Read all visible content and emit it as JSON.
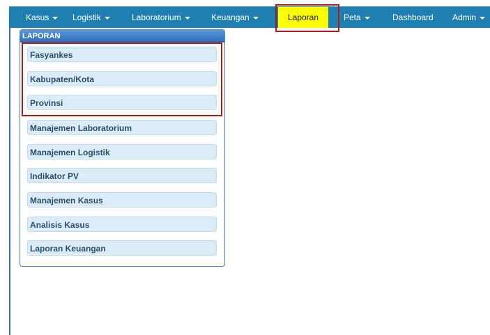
{
  "navbar": {
    "items": [
      {
        "label": "Kasus"
      },
      {
        "label": "Logistik"
      },
      {
        "label": "Laboratorium"
      },
      {
        "label": "Keuangan"
      },
      {
        "label": "Laporan"
      },
      {
        "label": "Peta"
      },
      {
        "label": "Dashboard"
      },
      {
        "label": "Admin"
      }
    ]
  },
  "panel": {
    "title": "LAPORAN",
    "items": [
      {
        "label": "Fasyankes"
      },
      {
        "label": "Kabupaten/Kota"
      },
      {
        "label": "Provinsi"
      },
      {
        "label": "Manajemen Laboratorium"
      },
      {
        "label": "Manajemen Logistik"
      },
      {
        "label": "Indikator PV"
      },
      {
        "label": "Manajemen Kasus"
      },
      {
        "label": "Analisis Kasus"
      },
      {
        "label": "Laporan Keuangan"
      }
    ]
  },
  "colors": {
    "navbar_bg": "#1e7fb0",
    "active_tab_bg": "#ffff00",
    "highlight_border": "#b01818",
    "panel_header": "#2d6db5",
    "menu_button_bg": "#dcecf7"
  }
}
